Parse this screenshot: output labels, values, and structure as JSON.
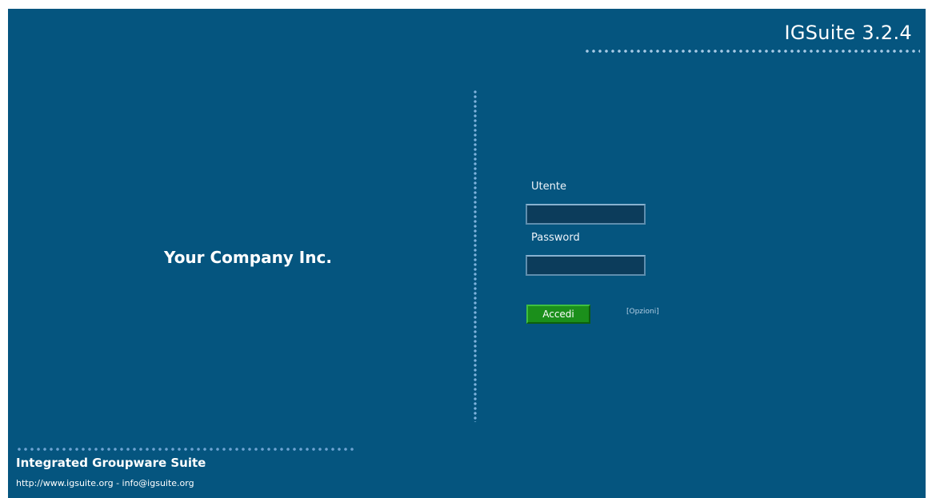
{
  "header": {
    "app_title": "IGSuite 3.2.4"
  },
  "brand": {
    "company_name": "Your Company Inc."
  },
  "login": {
    "username_label": "Utente",
    "username_value": "",
    "password_label": "Password",
    "password_value": "",
    "submit_label": "Accedi",
    "options_label": "[Opzioni]"
  },
  "footer": {
    "title": "Integrated Groupware Suite",
    "contact": "http://www.igsuite.org - info@igsuite.org"
  },
  "colors": {
    "background": "#05557f",
    "button": "#1b8f1b",
    "input_background": "#0c3c5b",
    "dots": "#7fb3dd"
  }
}
